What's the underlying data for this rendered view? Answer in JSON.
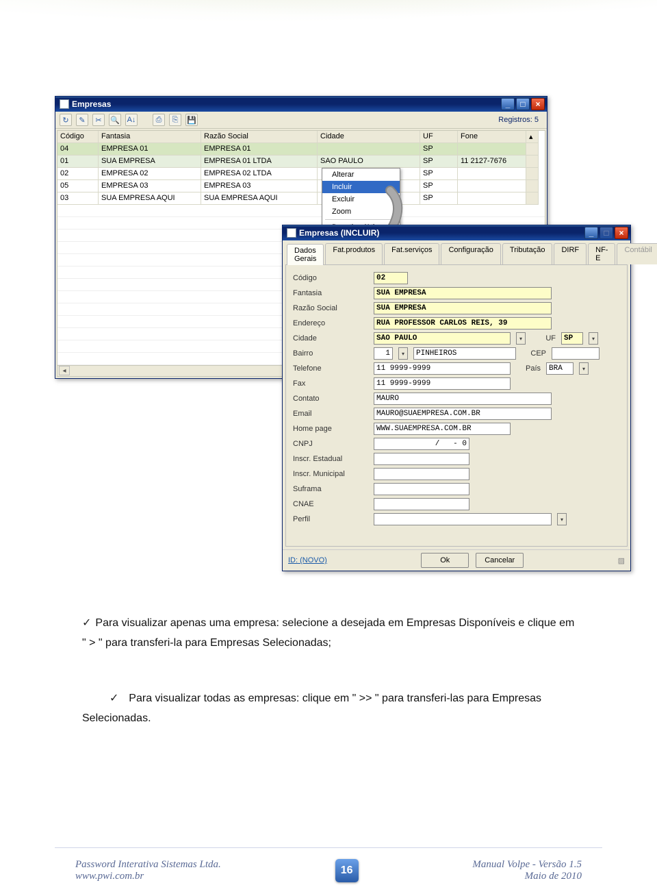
{
  "window1": {
    "title": "Empresas",
    "registros_label": "Registros:",
    "registros_value": "5",
    "toolbar_icons": [
      "refresh",
      "new",
      "search",
      "find",
      "sort",
      "",
      "print",
      "printall",
      "save"
    ],
    "columns": [
      "Código",
      "Fantasia",
      "Razão Social",
      "Cidade",
      "UF",
      "Fone",
      ""
    ],
    "rows": [
      {
        "codigo": "04",
        "fantasia": "EMPRESA 01",
        "razao": "EMPRESA 01",
        "cidade": "",
        "uf": "SP",
        "fone": "",
        "sel": false,
        "hl": true
      },
      {
        "codigo": "01",
        "fantasia": "SUA EMPRESA",
        "razao": "EMPRESA 01 LTDA",
        "cidade": "SAO PAULO",
        "uf": "SP",
        "fone": "11 2127-7676",
        "sel": true,
        "hl": false
      },
      {
        "codigo": "02",
        "fantasia": "EMPRESA 02",
        "razao": "EMPRESA 02 LTDA",
        "cidade": "",
        "uf": "SP",
        "fone": "",
        "sel": false,
        "hl": false
      },
      {
        "codigo": "05",
        "fantasia": "EMPRESA 03",
        "razao": "EMPRESA 03",
        "cidade": "",
        "uf": "SP",
        "fone": "",
        "sel": false,
        "hl": false
      },
      {
        "codigo": "03",
        "fantasia": "SUA EMPRESA AQUI",
        "razao": "SUA EMPRESA AQUI",
        "cidade": "",
        "uf": "SP",
        "fone": "",
        "sel": false,
        "hl": false
      }
    ]
  },
  "ctx": {
    "items": [
      "Alterar",
      "Incluir",
      "Excluir",
      "Zoom",
      "Desativar/Ativar"
    ],
    "selected_index": 1
  },
  "window2": {
    "title": "Empresas (INCLUIR)",
    "tabs": [
      "Dados Gerais",
      "Fat.produtos",
      "Fat.serviços",
      "Configuração",
      "Tributação",
      "DIRF",
      "NF-E",
      "Contábil"
    ],
    "active_tab": 0,
    "disabled_tab": 7,
    "labels": {
      "codigo": "Código",
      "fantasia": "Fantasia",
      "razao": "Razão Social",
      "endereco": "Endereço",
      "cidade": "Cidade",
      "bairro": "Bairro",
      "telefone": "Telefone",
      "fax": "Fax",
      "contato": "Contato",
      "email": "Email",
      "homepage": "Home page",
      "cnpj": "CNPJ",
      "inscr_est": "Inscr. Estadual",
      "inscr_mun": "Inscr. Municipal",
      "suframa": "Suframa",
      "cnae": "CNAE",
      "perfil": "Perfil",
      "uf": "UF",
      "cep": "CEP",
      "pais": "País"
    },
    "values": {
      "codigo": "02",
      "fantasia": "SUA EMPRESA",
      "razao": "SUA EMPRESA",
      "endereco": "RUA PROFESSOR CARLOS REIS, 39",
      "cidade": "SÃO PAULO",
      "bairro_code": "1",
      "bairro": "PINHEIROS",
      "telefone": "11 9999-9999",
      "fax": "11 9999-9999",
      "contato": "MAURO",
      "email": "MAURO@SUAEMPRESA.COM.BR",
      "homepage": "WWW.SUAEMPRESA.COM.BR",
      "cnpj": "/   - 0",
      "inscr_est": "",
      "inscr_mun": "",
      "suframa": "",
      "cnae": "",
      "perfil": "",
      "uf": "SP",
      "cep": "",
      "pais": "BRA"
    },
    "buttons": {
      "ok": "Ok",
      "cancel": "Cancelar"
    },
    "status": "ID: (NOVO)"
  },
  "body": {
    "p1": "Para visualizar apenas uma empresa: selecione a desejada em Empresas Disponíveis e clique em \" > \" para transferi-la para Empresas Selecionadas;",
    "p2": "Para visualizar todas as empresas: clique em \" >> \" para transferi-las para Empresas Selecionadas."
  },
  "footer": {
    "left1": "Password Interativa Sistemas Ltda.",
    "left2": "www.pwi.com.br",
    "right1": "Manual Volpe - Versão 1.5",
    "right2": "Maio de 2010",
    "page": "16"
  }
}
